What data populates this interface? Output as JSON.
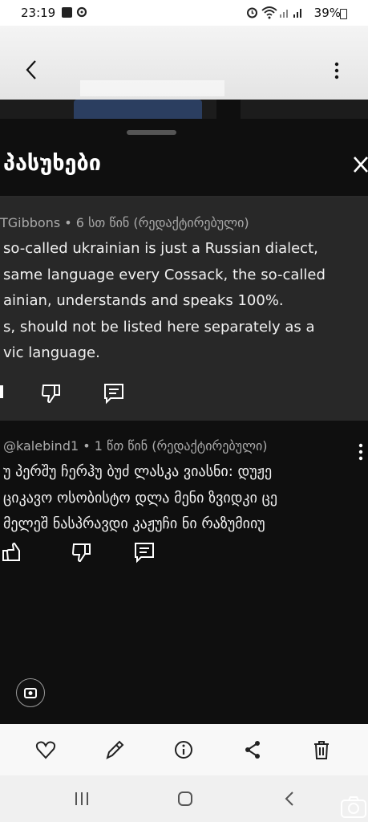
{
  "status_bar": {
    "time": "23:19",
    "battery": "39%"
  },
  "sheet": {
    "title": "პასუხები",
    "comments": [
      {
        "meta": "TGibbons • 6 სთ წინ (რედაქტირებული)",
        "lines": [
          " so-called ukrainian is just a Russian dialect,",
          " same language every Cossack, the so-called",
          "ainian, understands and speaks 100%.",
          "s, should not be listed here separately as a",
          "vic language."
        ]
      },
      {
        "meta": "@kalebind1 • 1 წთ წინ (რედაქტირებული)",
        "lines": [
          "უ პერშუ ჩერჰუ ბუძ ლასკა ვიასნი: დუჟე",
          "ციკავო ოსობისტო დლა მენი ზვიდკი ცე",
          "მელეშ ნასპრავდი კაჟუჩი ნი რაზუმიიუ"
        ]
      }
    ]
  },
  "icons": {
    "back": "chevron-left-icon",
    "more": "more-vert-icon",
    "close": "close-icon",
    "like": "thumb-up-icon",
    "dislike": "thumb-down-icon",
    "reply": "comment-icon",
    "toolbar": [
      "heart-icon",
      "pencil-icon",
      "info-icon",
      "share-icon",
      "trash-icon"
    ],
    "nav": [
      "recents-icon",
      "home-icon",
      "back-icon"
    ]
  }
}
